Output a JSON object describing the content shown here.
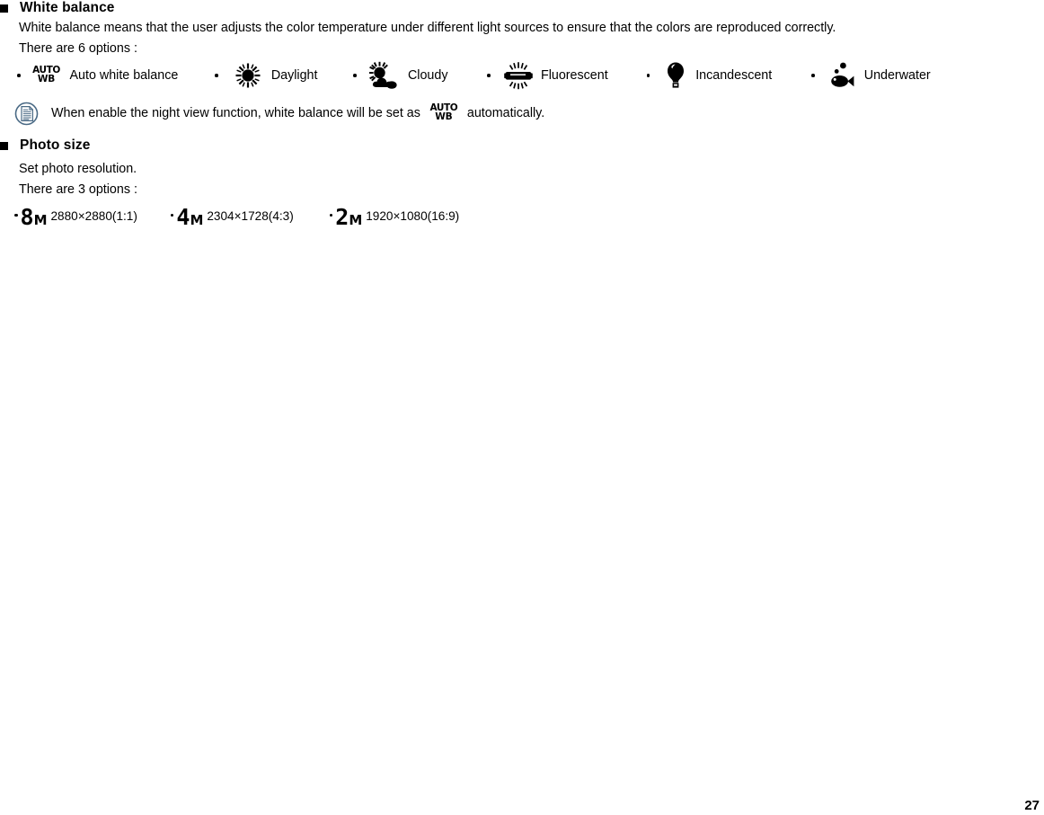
{
  "page": {
    "number": "27"
  },
  "sections": [
    {
      "title": "White balance",
      "description": "White balance means that the user adjusts the color temperature under different light sources to ensure that the colors are reproduced correctly.",
      "options_intro": "There are 6 options :",
      "options": [
        {
          "icon": "auto-white-balance-icon",
          "label": "Auto white balance"
        },
        {
          "icon": "daylight-sun-icon",
          "label": "Daylight"
        },
        {
          "icon": "cloudy-icon",
          "label": "Cloudy"
        },
        {
          "icon": "fluorescent-tube-icon",
          "label": "Fluorescent"
        },
        {
          "icon": "incandescent-bulb-icon",
          "label": "Incandescent"
        },
        {
          "icon": "underwater-fish-icon",
          "label": "Underwater"
        }
      ],
      "note": {
        "icon": "note-document-icon",
        "text_before": "When enable the night view function, white balance will be set as",
        "inline_icon": "auto-white-balance-icon",
        "text_after": "automatically."
      }
    },
    {
      "title": "Photo size",
      "description": "Set photo resolution.",
      "options_intro": "There are 3 options :",
      "sizes": [
        {
          "icon": "8m-size-icon",
          "badge_num": "8",
          "badge_unit": "M",
          "label": "2880×2880(1:1)"
        },
        {
          "icon": "4m-size-icon",
          "badge_num": "4",
          "badge_unit": "M",
          "label": "2304×1728(4:3)"
        },
        {
          "icon": "2m-size-icon",
          "badge_num": "2",
          "badge_unit": "M",
          "label": "1920×1080(16:9)"
        }
      ]
    }
  ],
  "auto_wb_glyph": {
    "line1": "AUTO",
    "line2": "WB"
  },
  "colors": {
    "text": "#000000",
    "note_icon_outline": "#4a6a85",
    "background": "#ffffff"
  }
}
